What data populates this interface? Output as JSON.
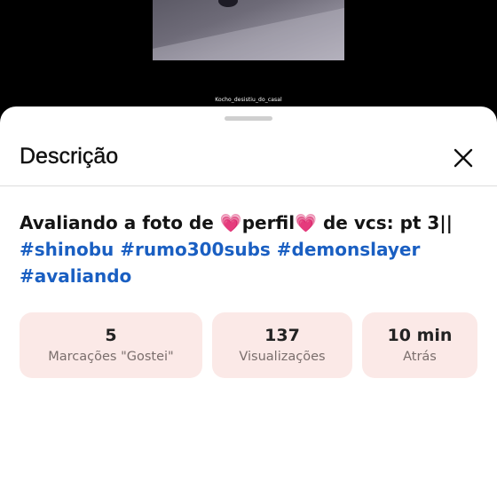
{
  "video": {
    "watermark": "Kocho_desistiu_do_casal"
  },
  "sheet": {
    "title": "Descrição",
    "close_icon": "close-x-icon"
  },
  "description": {
    "text_before": "Avaliando a foto de ",
    "heart_1": "💗",
    "text_middle": "perfil",
    "heart_2": "💗",
    "text_after": " de vcs: pt 3||",
    "hashtags": [
      "#shinobu",
      "#rumo300subs",
      "#demonslayer",
      "#avaliando"
    ],
    "hashtag_color": "#1a5fc2"
  },
  "stats": [
    {
      "value": "5",
      "label": "Marcações \"Gostei\""
    },
    {
      "value": "137",
      "label": "Visualizações"
    },
    {
      "value": "10 min",
      "label": "Atrás"
    }
  ],
  "colors": {
    "stat_background": "#fbe9e7",
    "sheet_background": "#ffffff"
  }
}
